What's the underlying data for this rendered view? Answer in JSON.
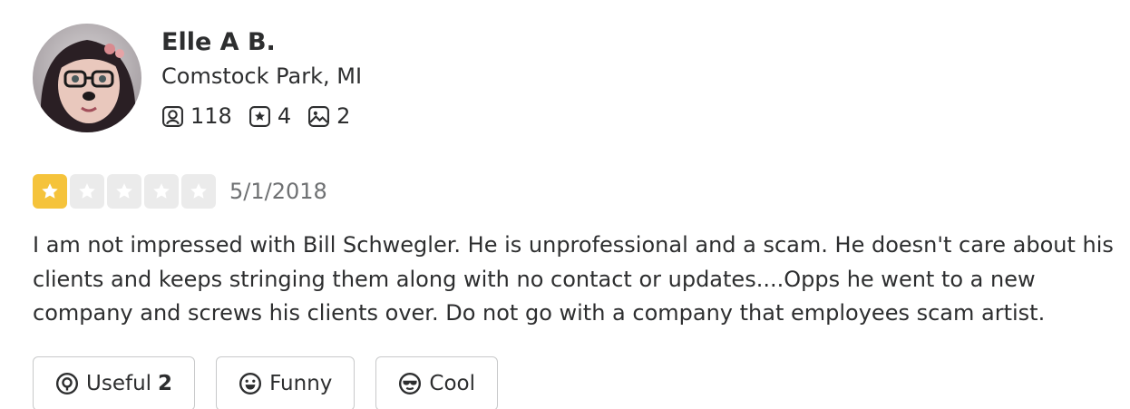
{
  "user": {
    "name": "Elle A B.",
    "location": "Comstock Park, MI",
    "friends_count": "118",
    "reviews_count": "4",
    "photos_count": "2"
  },
  "review": {
    "rating": 1,
    "max_rating": 5,
    "date": "5/1/2018",
    "text_lines": [
      "I am not impressed with Bill Schwegler. He is unprofessional and a scam. He doesn't care about his",
      "clients and keeps stringing them along with no contact or updates....Opps he went to a new",
      "company and screws his clients over. Do not go with a company that employees scam artist."
    ]
  },
  "reactions": {
    "useful_label": "Useful",
    "useful_count": "2",
    "funny_label": "Funny",
    "cool_label": "Cool"
  },
  "icons": {
    "friends": "friends-icon",
    "reviews": "review-star-icon",
    "photos": "photo-icon",
    "useful": "lightbulb-icon",
    "funny": "smile-icon",
    "cool": "sunglasses-icon"
  },
  "colors": {
    "star_filled": "#f5c33b",
    "star_empty": "#ebebeb",
    "text": "#2d2e2f",
    "muted": "#6e7072",
    "border": "#c8c9ca"
  }
}
